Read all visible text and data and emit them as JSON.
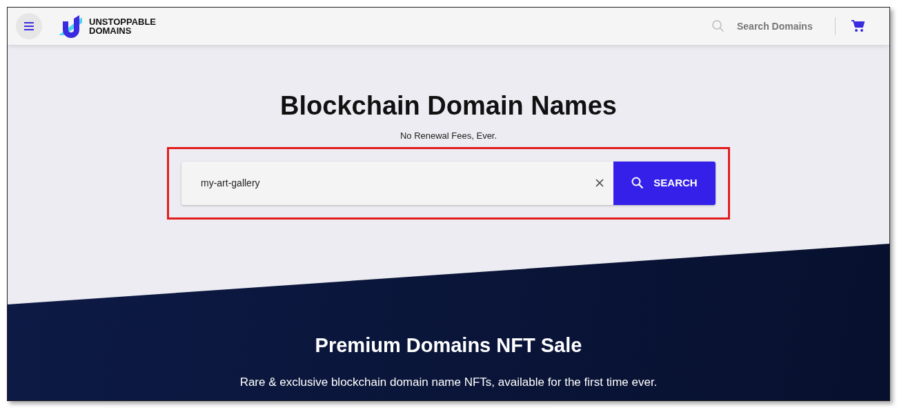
{
  "header": {
    "logo_text": [
      "UNSTOPPABLE",
      "DOMAINS"
    ],
    "search": {
      "placeholder": "Search Domains"
    }
  },
  "hero": {
    "title": "Blockchain Domain Names",
    "subtitle": "No Renewal Fees, Ever.",
    "search": {
      "value": "my-art-gallery",
      "button": "SEARCH"
    }
  },
  "promo": {
    "title": "Premium Domains NFT Sale",
    "subtitle": "Rare & exclusive blockchain domain name NFTs, available for the first time ever."
  }
}
